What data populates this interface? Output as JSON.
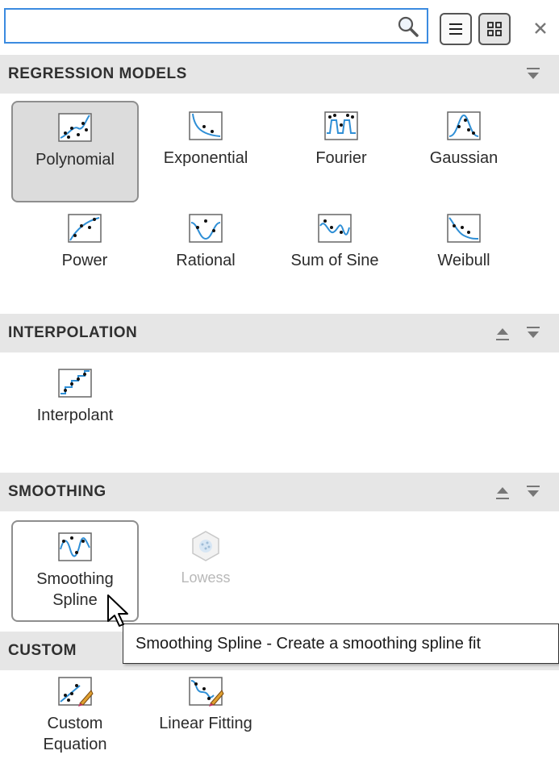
{
  "search": {
    "value": "",
    "placeholder": ""
  },
  "toolbar": {
    "list_view": "list-view",
    "grid_view": "grid-view",
    "close": "close"
  },
  "sections": {
    "regression": {
      "title": "REGRESSION MODELS",
      "items": [
        {
          "label": "Polynomial"
        },
        {
          "label": "Exponential"
        },
        {
          "label": "Fourier"
        },
        {
          "label": "Gaussian"
        },
        {
          "label": "Power"
        },
        {
          "label": "Rational"
        },
        {
          "label": "Sum of Sine"
        },
        {
          "label": "Weibull"
        }
      ]
    },
    "interpolation": {
      "title": "INTERPOLATION",
      "items": [
        {
          "label": "Interpolant"
        }
      ]
    },
    "smoothing": {
      "title": "SMOOTHING",
      "items": [
        {
          "label_line1": "Smoothing",
          "label_line2": "Spline"
        },
        {
          "label": "Lowess"
        }
      ]
    },
    "custom": {
      "title": "CUSTOM",
      "items": [
        {
          "label_line1": "Custom",
          "label_line2": "Equation"
        },
        {
          "label": "Linear Fitting"
        }
      ]
    }
  },
  "tooltip": {
    "text": "Smoothing Spline - Create a smoothing spline fit"
  },
  "colors": {
    "accent": "#3b8be0",
    "curve": "#2f8fd6",
    "header_bg": "#e6e6e6"
  }
}
